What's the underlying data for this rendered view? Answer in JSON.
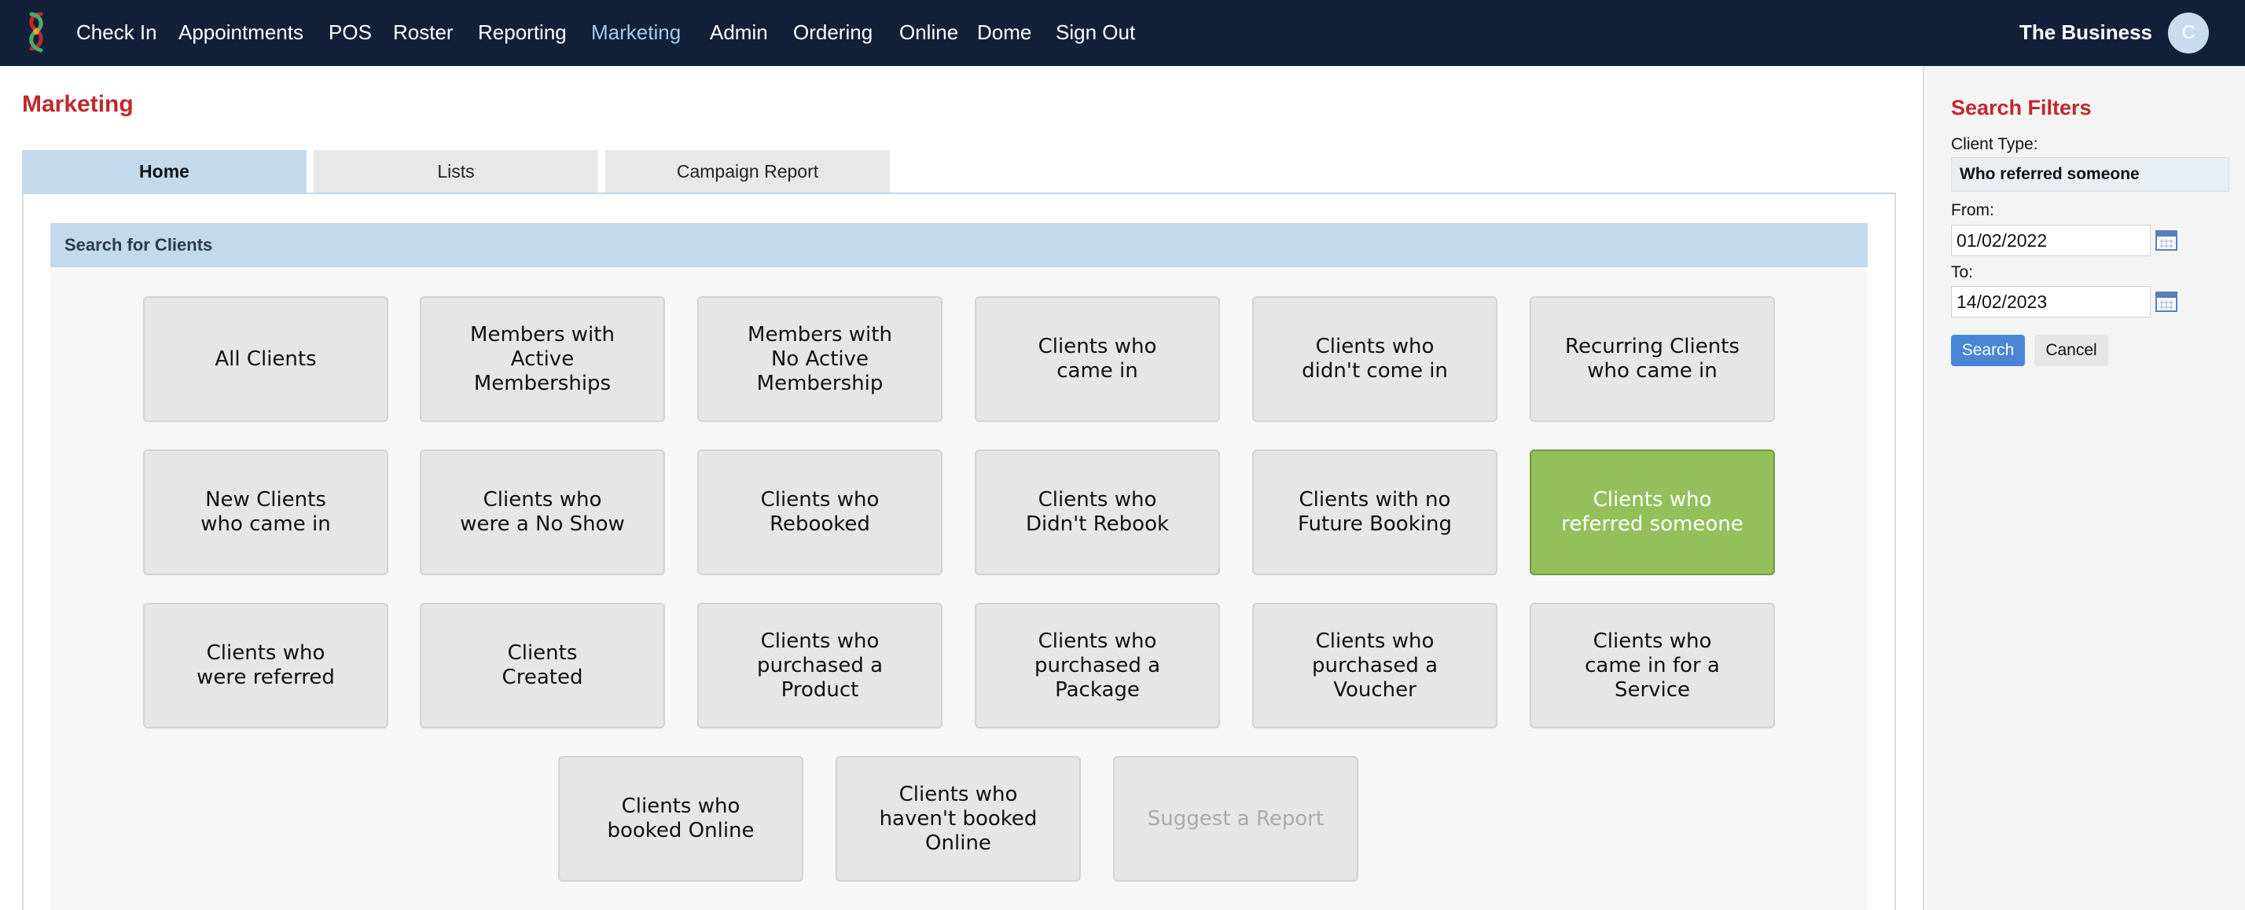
{
  "nav": {
    "items": [
      "Check In",
      "Appointments",
      "POS",
      "Roster",
      "Reporting",
      "Marketing",
      "Admin",
      "Ordering",
      "Online",
      "Dome",
      "Sign Out"
    ],
    "active": "Marketing",
    "business_name": "The Business",
    "avatar_initial": "C"
  },
  "page": {
    "title": "Marketing",
    "tabs": [
      "Home",
      "Lists",
      "Campaign Report"
    ],
    "active_tab": "Home",
    "section_header": "Search for Clients"
  },
  "tiles": [
    {
      "label": "All Clients",
      "state": "normal"
    },
    {
      "label": "Members with\nActive\nMemberships",
      "state": "normal"
    },
    {
      "label": "Members with\nNo Active\nMembership",
      "state": "normal"
    },
    {
      "label": "Clients who\ncame in",
      "state": "normal"
    },
    {
      "label": "Clients who\ndidn't come in",
      "state": "normal"
    },
    {
      "label": "Recurring Clients\nwho came in",
      "state": "normal"
    },
    {
      "label": "New Clients\nwho came in",
      "state": "normal"
    },
    {
      "label": "Clients who\nwere a No Show",
      "state": "normal"
    },
    {
      "label": "Clients who\nRebooked",
      "state": "normal"
    },
    {
      "label": "Clients who\nDidn't Rebook",
      "state": "normal"
    },
    {
      "label": "Clients with no\nFuture Booking",
      "state": "normal"
    },
    {
      "label": "Clients who\nreferred someone",
      "state": "selected"
    },
    {
      "label": "Clients who\nwere referred",
      "state": "normal"
    },
    {
      "label": "Clients\nCreated",
      "state": "normal"
    },
    {
      "label": "Clients who\npurchased a\nProduct",
      "state": "normal"
    },
    {
      "label": "Clients who\npurchased a\nPackage",
      "state": "normal"
    },
    {
      "label": "Clients who\npurchased a\nVoucher",
      "state": "normal"
    },
    {
      "label": "Clients who\ncame in for a\nService",
      "state": "normal"
    },
    {
      "label": "Clients who\nbooked Online",
      "state": "normal"
    },
    {
      "label": "Clients who\nhaven't booked\nOnline",
      "state": "normal"
    },
    {
      "label": "Suggest a Report",
      "state": "disabled"
    }
  ],
  "filters": {
    "title": "Search Filters",
    "client_type_label": "Client Type:",
    "client_type_value": "Who referred someone",
    "from_label": "From:",
    "from_value": "01/02/2022",
    "to_label": "To:",
    "to_value": "14/02/2023",
    "search_label": "Search",
    "cancel_label": "Cancel"
  },
  "colors": {
    "nav_bg": "#13203a",
    "accent_red": "#c0282d",
    "selected_green": "#93c05b",
    "tab_active": "#c3d9ec",
    "search_blue": "#4a86d6"
  }
}
